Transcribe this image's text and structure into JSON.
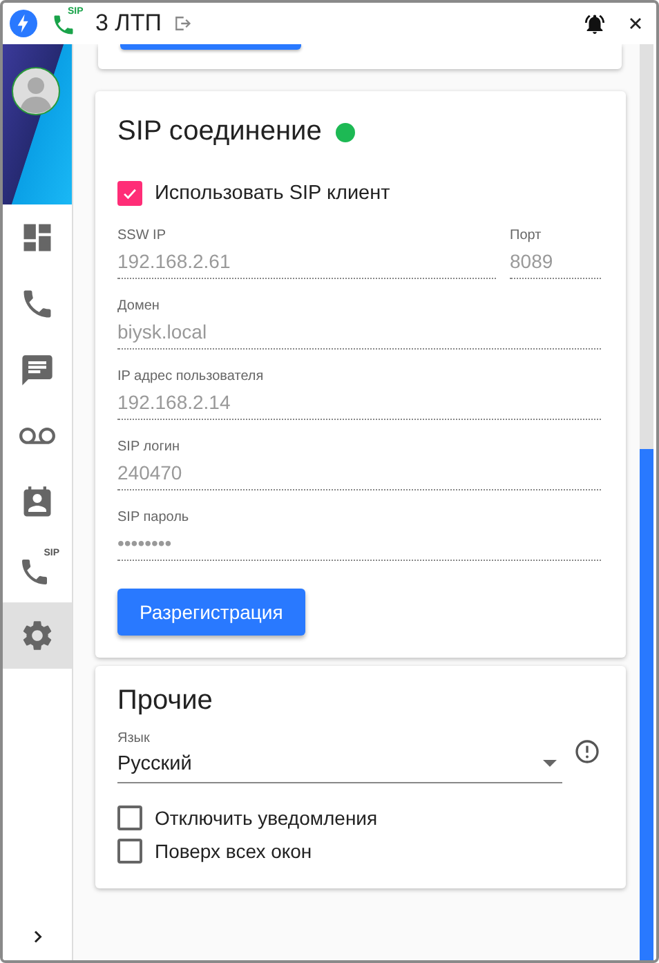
{
  "title_bar": {
    "phone_badge": "SIP",
    "title": "3 ЛТП"
  },
  "nav": {
    "items": [
      {
        "kind": "dashboard",
        "selected": false
      },
      {
        "kind": "phone",
        "selected": false
      },
      {
        "kind": "chat",
        "selected": false
      },
      {
        "kind": "voicemail",
        "selected": false
      },
      {
        "kind": "contacts",
        "selected": false
      },
      {
        "kind": "sip",
        "badge": "SIP",
        "selected": false
      },
      {
        "kind": "settings",
        "selected": true
      }
    ]
  },
  "sip_section": {
    "title": "SIP соединение",
    "connected": true,
    "use_sip_client": {
      "label": "Использовать SIP клиент",
      "checked": true
    },
    "field_rows": [
      [
        {
          "label": "SSW IP",
          "value": "192.168.2.61",
          "disabled": true
        },
        {
          "label": "Порт",
          "value": "8089",
          "disabled": true
        }
      ],
      [
        {
          "label": "Домен",
          "value": "biysk.local",
          "disabled": true
        }
      ],
      [
        {
          "label": "IP адрес пользователя",
          "value": "192.168.2.14",
          "disabled": true
        }
      ],
      [
        {
          "label": "SIP логин",
          "value": "240470",
          "disabled": true
        }
      ],
      [
        {
          "label": "SIP пароль",
          "value": "••••••••",
          "disabled": true
        }
      ]
    ],
    "button": "Разрегистрация"
  },
  "other_section": {
    "title": "Прочие",
    "language": {
      "label": "Язык",
      "value": "Русский"
    },
    "checkboxes": [
      {
        "label": "Отключить уведомления",
        "checked": false
      },
      {
        "label": "Поверх всех окон",
        "checked": false
      }
    ]
  }
}
